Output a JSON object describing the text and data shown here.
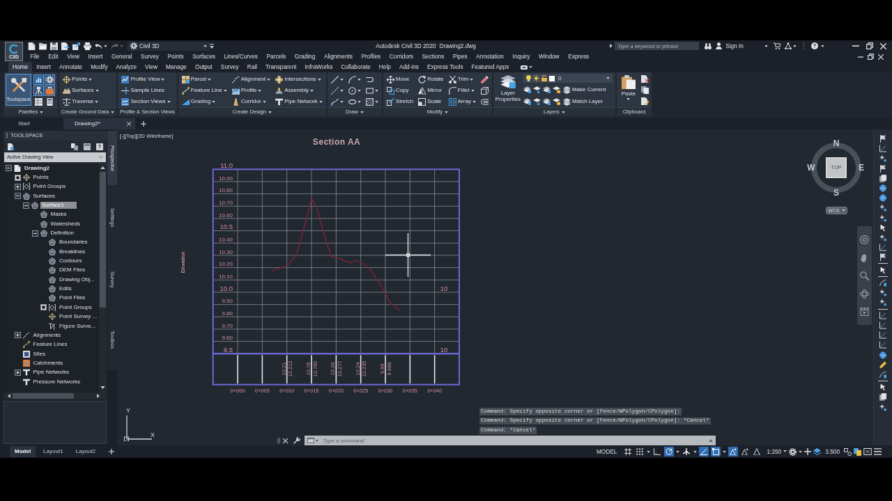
{
  "title_bar": {
    "app_badge": "C3D",
    "quick_access": [
      {
        "disabled": false,
        "dropdown": false
      },
      {
        "disabled": false,
        "dropdown": false
      },
      {
        "disabled": false,
        "dropdown": false
      },
      {
        "disabled": false,
        "dropdown": false
      },
      {
        "disabled": false,
        "dropdown": false
      },
      {
        "disabled": false,
        "dropdown": false
      },
      {
        "disabled": false,
        "dropdown": true
      },
      {
        "disabled": true,
        "dropdown": true
      }
    ],
    "workspace": "Civil 3D",
    "title": "Autodesk Civil 3D 2020",
    "file_name": "Drawing2.dwg",
    "search": {
      "placeholder": "Type a keyword or phrase"
    },
    "sign_in": "Sign In",
    "help": "?"
  },
  "menu_bar": [
    "File",
    "Edit",
    "View",
    "Insert",
    "General",
    "Survey",
    "Points",
    "Surfaces",
    "Lines/Curves",
    "Parcels",
    "Grading",
    "Alignments",
    "Profiles",
    "Corridors",
    "Sections",
    "Pipes",
    "Annotation",
    "Inquiry",
    "Window",
    "Express"
  ],
  "ribbon_tabs": [
    {
      "label": "Home",
      "selected": true
    },
    {
      "label": "Insert",
      "selected": false
    },
    {
      "label": "Annotate",
      "selected": false
    },
    {
      "label": "Modify",
      "selected": false
    },
    {
      "label": "Analyze",
      "selected": false
    },
    {
      "label": "View",
      "selected": false
    },
    {
      "label": "Manage",
      "selected": false
    },
    {
      "label": "Output",
      "selected": false
    },
    {
      "label": "Survey",
      "selected": false
    },
    {
      "label": "Rail",
      "selected": false
    },
    {
      "label": "Transparent",
      "selected": false
    },
    {
      "label": "InfraWorks",
      "selected": false
    },
    {
      "label": "Collaborate",
      "selected": false
    },
    {
      "label": "Help",
      "selected": false
    },
    {
      "label": "Add-ins",
      "selected": false
    },
    {
      "label": "Express Tools",
      "selected": false
    },
    {
      "label": "Featured Apps",
      "selected": false
    }
  ],
  "ribbon_panels": [
    {
      "kind": "palettes",
      "title": "Palettes",
      "dropdown": true,
      "large": {
        "label": "Toolspace",
        "on": true
      },
      "tools": [
        {
          "on": true
        },
        {
          "on": true
        },
        {
          "on": true
        },
        {
          "on": true
        },
        {
          "on": false
        },
        {
          "on": false
        }
      ]
    },
    {
      "kind": "tools",
      "title": "Create Ground Data",
      "dropdown": true,
      "columns": [
        [
          {
            "label": "Points",
            "dropdown": true
          },
          {
            "label": "Surfaces",
            "dropdown": true
          },
          {
            "label": "Traverse",
            "dropdown": true
          }
        ]
      ]
    },
    {
      "kind": "tools",
      "title": "Profile & Section Views",
      "dropdown": false,
      "columns": [
        [
          {
            "label": "Profile View",
            "dropdown": true
          },
          {
            "label": "Sample Lines",
            "dropdown": false
          },
          {
            "label": "Section Views",
            "dropdown": true
          }
        ]
      ]
    },
    {
      "kind": "tools",
      "title": "Create Design",
      "dropdown": true,
      "columns": [
        [
          {
            "label": "Parcel",
            "dropdown": true
          },
          {
            "label": "Feature Line",
            "dropdown": true
          },
          {
            "label": "Grading",
            "dropdown": true
          }
        ],
        [
          {
            "label": "Alignment",
            "dropdown": true
          },
          {
            "label": "Profile",
            "dropdown": true
          },
          {
            "label": "Corridor",
            "dropdown": true
          }
        ],
        [
          {
            "label": "Intersections",
            "dropdown": true
          },
          {
            "label": "Assembly",
            "dropdown": true
          },
          {
            "label": "Pipe Network",
            "dropdown": true
          }
        ]
      ]
    },
    {
      "kind": "tools",
      "title": "Draw",
      "dropdown": true,
      "columns": [
        [
          {
            "dropdown": true
          },
          {
            "dropdown": true
          },
          {
            "dropdown": true
          }
        ],
        [
          {
            "dropdown": true
          },
          {
            "dropdown": true
          },
          {
            "dropdown": true
          }
        ],
        [
          {
            "dropdown": false
          },
          {
            "dropdown": true
          },
          {
            "dropdown": true
          }
        ]
      ]
    },
    {
      "kind": "tools",
      "title": "Modify",
      "dropdown": true,
      "columns": [
        [
          {
            "label": "Move",
            "dropdown": false
          },
          {
            "label": "Copy",
            "dropdown": false
          },
          {
            "label": "Stretch",
            "dropdown": false
          }
        ],
        [
          {
            "label": "Rotate",
            "dropdown": false
          },
          {
            "label": "Mirror",
            "dropdown": false
          },
          {
            "label": "Scale",
            "dropdown": false
          }
        ],
        [
          {
            "label": "Trim",
            "dropdown": true
          },
          {
            "label": "Fillet",
            "dropdown": true
          },
          {
            "label": "Array",
            "dropdown": true
          }
        ],
        [
          {
            "dropdown": false
          },
          {
            "dropdown": false
          },
          {
            "dropdown": false
          }
        ]
      ]
    },
    {
      "kind": "layers",
      "title": "Layers",
      "dropdown": true,
      "large": {
        "label": "Layer Properties"
      },
      "current_layer": "0",
      "rows": [
        {
          "label": "Make Current"
        },
        {
          "label": "Match Layer"
        }
      ]
    },
    {
      "kind": "clipboard",
      "title": "Clipboard",
      "dropdown": false,
      "large": {
        "label": "Paste",
        "dropdown": true
      }
    }
  ],
  "file_tabs": [
    {
      "label": "Start",
      "selected": false,
      "closable": false
    },
    {
      "label": "Drawing2*",
      "selected": true,
      "closable": true
    }
  ],
  "toolspace": {
    "title": "TOOLSPACE",
    "help": "?",
    "view_selector": "Active Drawing View",
    "tree": [
      {
        "label": "Drawing2",
        "expanded": true,
        "filled": false,
        "selected": false,
        "children": [
          {
            "label": "Points",
            "expanded": false,
            "filled": true,
            "selected": false
          },
          {
            "label": "Point Groups",
            "expanded": false,
            "filled": false,
            "selected": false
          },
          {
            "label": "Surfaces",
            "expanded": true,
            "filled": false,
            "selected": false,
            "children": [
              {
                "label": "Surface1",
                "expanded": true,
                "filled": false,
                "selected": true,
                "children": [
                  {
                    "label": "Masks",
                    "selected": false
                  },
                  {
                    "label": "Watersheds",
                    "selected": false
                  },
                  {
                    "label": "Definition",
                    "expanded": true,
                    "filled": false,
                    "selected": false,
                    "children": [
                      {
                        "label": "Boundaries",
                        "selected": false
                      },
                      {
                        "label": "Breaklines",
                        "selected": false
                      },
                      {
                        "label": "Contours",
                        "selected": false
                      },
                      {
                        "label": "DEM Files",
                        "selected": false
                      },
                      {
                        "label": "Drawing Obj...",
                        "selected": false
                      },
                      {
                        "label": "Edits",
                        "selected": false
                      },
                      {
                        "label": "Point Files",
                        "selected": false
                      },
                      {
                        "label": "Point Groups",
                        "expanded": false,
                        "filled": true,
                        "selected": false
                      },
                      {
                        "label": "Point Survey ...",
                        "selected": false
                      },
                      {
                        "label": "Figure Surve...",
                        "selected": false
                      }
                    ]
                  }
                ]
              }
            ]
          },
          {
            "label": "Alignments",
            "expanded": false,
            "filled": false,
            "selected": false
          },
          {
            "label": "Feature Lines",
            "selected": false
          },
          {
            "label": "Sites",
            "selected": false
          },
          {
            "label": "Catchments",
            "selected": false
          },
          {
            "label": "Pipe Networks",
            "expanded": false,
            "filled": false,
            "selected": false
          },
          {
            "label": "Pressure Networks",
            "selected": false
          }
        ]
      }
    ],
    "side_tabs": [
      {
        "label": "Prospector",
        "selected": true
      },
      {
        "label": "Settings",
        "selected": false
      },
      {
        "label": "Survey",
        "selected": false
      },
      {
        "label": "Toolbox",
        "selected": false
      }
    ]
  },
  "viewport": {
    "view_controls": "[-][Top][2D Wireframe]",
    "view_cube": {
      "face": "TOP",
      "north": "N",
      "south": "S",
      "east": "E",
      "west": "W",
      "ucs_menu": "WCS"
    },
    "ucs_icon": {
      "x_label": "X",
      "y_label": "Y"
    }
  },
  "section_view": {
    "chart_data": {
      "type": "line",
      "title": "Section AA",
      "grid": true,
      "categories": [
        null,
        null,
        null,
        null,
        null,
        "0+000",
        null,
        null,
        null,
        null,
        "0+005",
        null,
        null,
        null,
        null,
        "0+010",
        null,
        null,
        null,
        null,
        "0+015",
        null,
        null,
        null,
        null,
        "0+020",
        null,
        null,
        null,
        null,
        "0+025",
        null,
        null,
        null,
        null,
        "0+030",
        null,
        null,
        null,
        null,
        "0+035",
        null,
        null,
        null,
        null,
        "0+040",
        null,
        null,
        null,
        null,
        null
      ],
      "series": [
        {
          "color": "#7a2434",
          "values": [
            null,
            null,
            null,
            null,
            null,
            null,
            null,
            null,
            null,
            null,
            null,
            null,
            10.17,
            10.19,
            10.2,
            10.21,
            10.26,
            10.31,
            10.46,
            10.6,
            10.76,
            10.7,
            10.55,
            10.41,
            10.29,
            10.28,
            10.27,
            10.25,
            10.24,
            10.26,
            10.24,
            10.22,
            10.18,
            10.12,
            10.06,
            9.99,
            9.91,
            9.88,
            9.85,
            null,
            null,
            null,
            null,
            null,
            null,
            null,
            null,
            null,
            null,
            null,
            null
          ]
        }
      ],
      "ylim": [
        9.5,
        11
      ],
      "yticks": [
        {
          "value": 9.5,
          "label": "9.5"
        },
        {
          "value": 9.6,
          "label": "9.60"
        },
        {
          "value": 9.7,
          "label": "9.70"
        },
        {
          "value": 9.8,
          "label": "9.80"
        },
        {
          "value": 9.9,
          "label": "9.90"
        },
        {
          "value": 10,
          "label": "10.0"
        },
        {
          "value": 10.1,
          "label": "10.10"
        },
        {
          "value": 10.2,
          "label": "10.20"
        },
        {
          "value": 10.3,
          "label": "10.30"
        },
        {
          "value": 10.4,
          "label": "10.40"
        },
        {
          "value": 10.5,
          "label": "10.5"
        },
        {
          "value": 10.6,
          "label": "10.60"
        },
        {
          "value": 10.7,
          "label": "10.70"
        },
        {
          "value": 10.8,
          "label": "10.80"
        },
        {
          "value": 10.9,
          "label": "10.90"
        },
        {
          "value": 11,
          "label": "11.0"
        }
      ],
      "annotations": [
        "Elevation",
        "10.21",
        "10.212",
        "10.76",
        "10.760",
        "10.28",
        "10.277",
        "10.24",
        "10.235",
        "9.99",
        "9.988",
        "10",
        "10"
      ]
    }
  },
  "command_line": {
    "history": [
      "Command: Specify opposite corner or [Fence/WPolygon/CPolygon]:",
      "Command: Specify opposite corner or [Fence/WPolygon/CPolygon]: *Cancel*",
      "Command: *Cancel*"
    ],
    "placeholder": "Type a command"
  },
  "layout_tabs": [
    {
      "label": "Model",
      "selected": true
    },
    {
      "label": "Layout1",
      "selected": false
    },
    {
      "label": "Layout2",
      "selected": false
    }
  ],
  "status_bar": {
    "space": "MODEL",
    "toggles": [
      {
        "on": false,
        "dropdown": false
      },
      {
        "on": false,
        "dropdown": true
      },
      {
        "on": false,
        "dropdown": false
      },
      {
        "on": true,
        "dropdown": true
      },
      {
        "on": false,
        "dropdown": true
      },
      {
        "on": true,
        "dropdown": false
      },
      {
        "on": true,
        "dropdown": true
      },
      {
        "on": true,
        "dropdown": false
      },
      {
        "on": false,
        "dropdown": false
      },
      {
        "on": false,
        "dropdown": false
      }
    ],
    "annotation_scale": "1:250",
    "lineweight": "3.500"
  }
}
